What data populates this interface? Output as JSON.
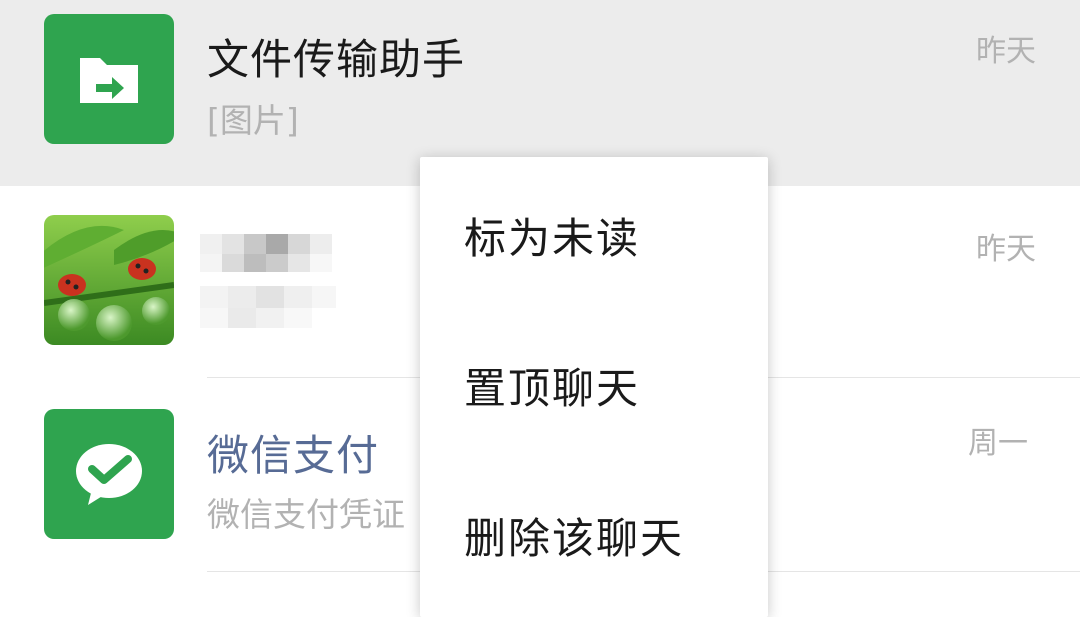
{
  "chats": [
    {
      "name": "文件传输助手",
      "preview": "[图片]",
      "time": "昨天",
      "icon": "folder-transfer-icon"
    },
    {
      "name": "",
      "preview": "",
      "time": "昨天",
      "icon": "ladybug-photo-avatar"
    },
    {
      "name": "微信支付",
      "preview": "微信支付凭证",
      "time": "周一",
      "icon": "wechat-pay-icon"
    }
  ],
  "context_menu": {
    "items": [
      {
        "label": "标为未读"
      },
      {
        "label": "置顶聊天"
      },
      {
        "label": "删除该聊天"
      }
    ]
  },
  "colors": {
    "avatar_green": "#2fa44f",
    "highlight_bg": "#ececec",
    "official_name_blue": "#576b95",
    "secondary_text": "#b2b2b2"
  }
}
